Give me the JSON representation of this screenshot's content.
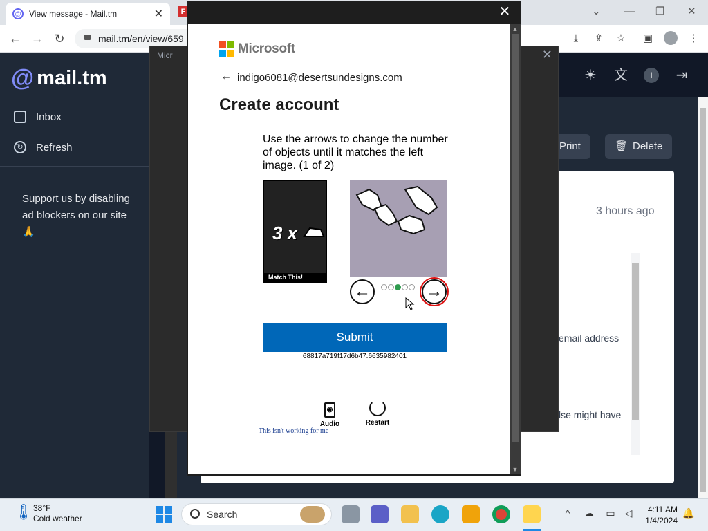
{
  "browser": {
    "tab_title": "View message - Mail.tm",
    "tab2_favicon_letter": "F",
    "url": "mail.tm/en/view/659",
    "nav": {
      "back": "←",
      "forward": "→",
      "reload": "↻"
    }
  },
  "site": {
    "logo_text": "mail.tm",
    "nav": [
      {
        "label": "Inbox"
      },
      {
        "label": "Refresh"
      }
    ],
    "support_text": "Support us by disabling ad blockers on our site 🙏",
    "user_initial": "I",
    "toolbar": {
      "print": "Print",
      "delete": "Delete"
    },
    "message": {
      "time": "3 hours ago",
      "line1": "email address",
      "line2": "lse might have"
    }
  },
  "overlay_dialog": {
    "title": "Micr"
  },
  "popup": {
    "brand": "Microsoft",
    "email": "indigo6081@desertsundesigns.com",
    "heading": "Create account",
    "puzzle": {
      "instruction": "Use the arrows to change the number of objects until it matches the left image. (1 of 2)",
      "left_count": "3 x",
      "left_caption": "Match This!",
      "dots": [
        false,
        false,
        true,
        false,
        false
      ],
      "submit": "Submit",
      "session_id": "68817a719f17d6b47.6635982401",
      "audio": "Audio",
      "restart": "Restart",
      "not_working": "This isn't working for me"
    }
  },
  "taskbar": {
    "temperature": "38°F",
    "weather": "Cold weather",
    "search": "Search",
    "time": "4:11 AM",
    "date": "1/4/2024"
  },
  "colors": {
    "accent": "#818cf8",
    "ms_blue": "#0067b8",
    "dark_bg": "#111827"
  }
}
